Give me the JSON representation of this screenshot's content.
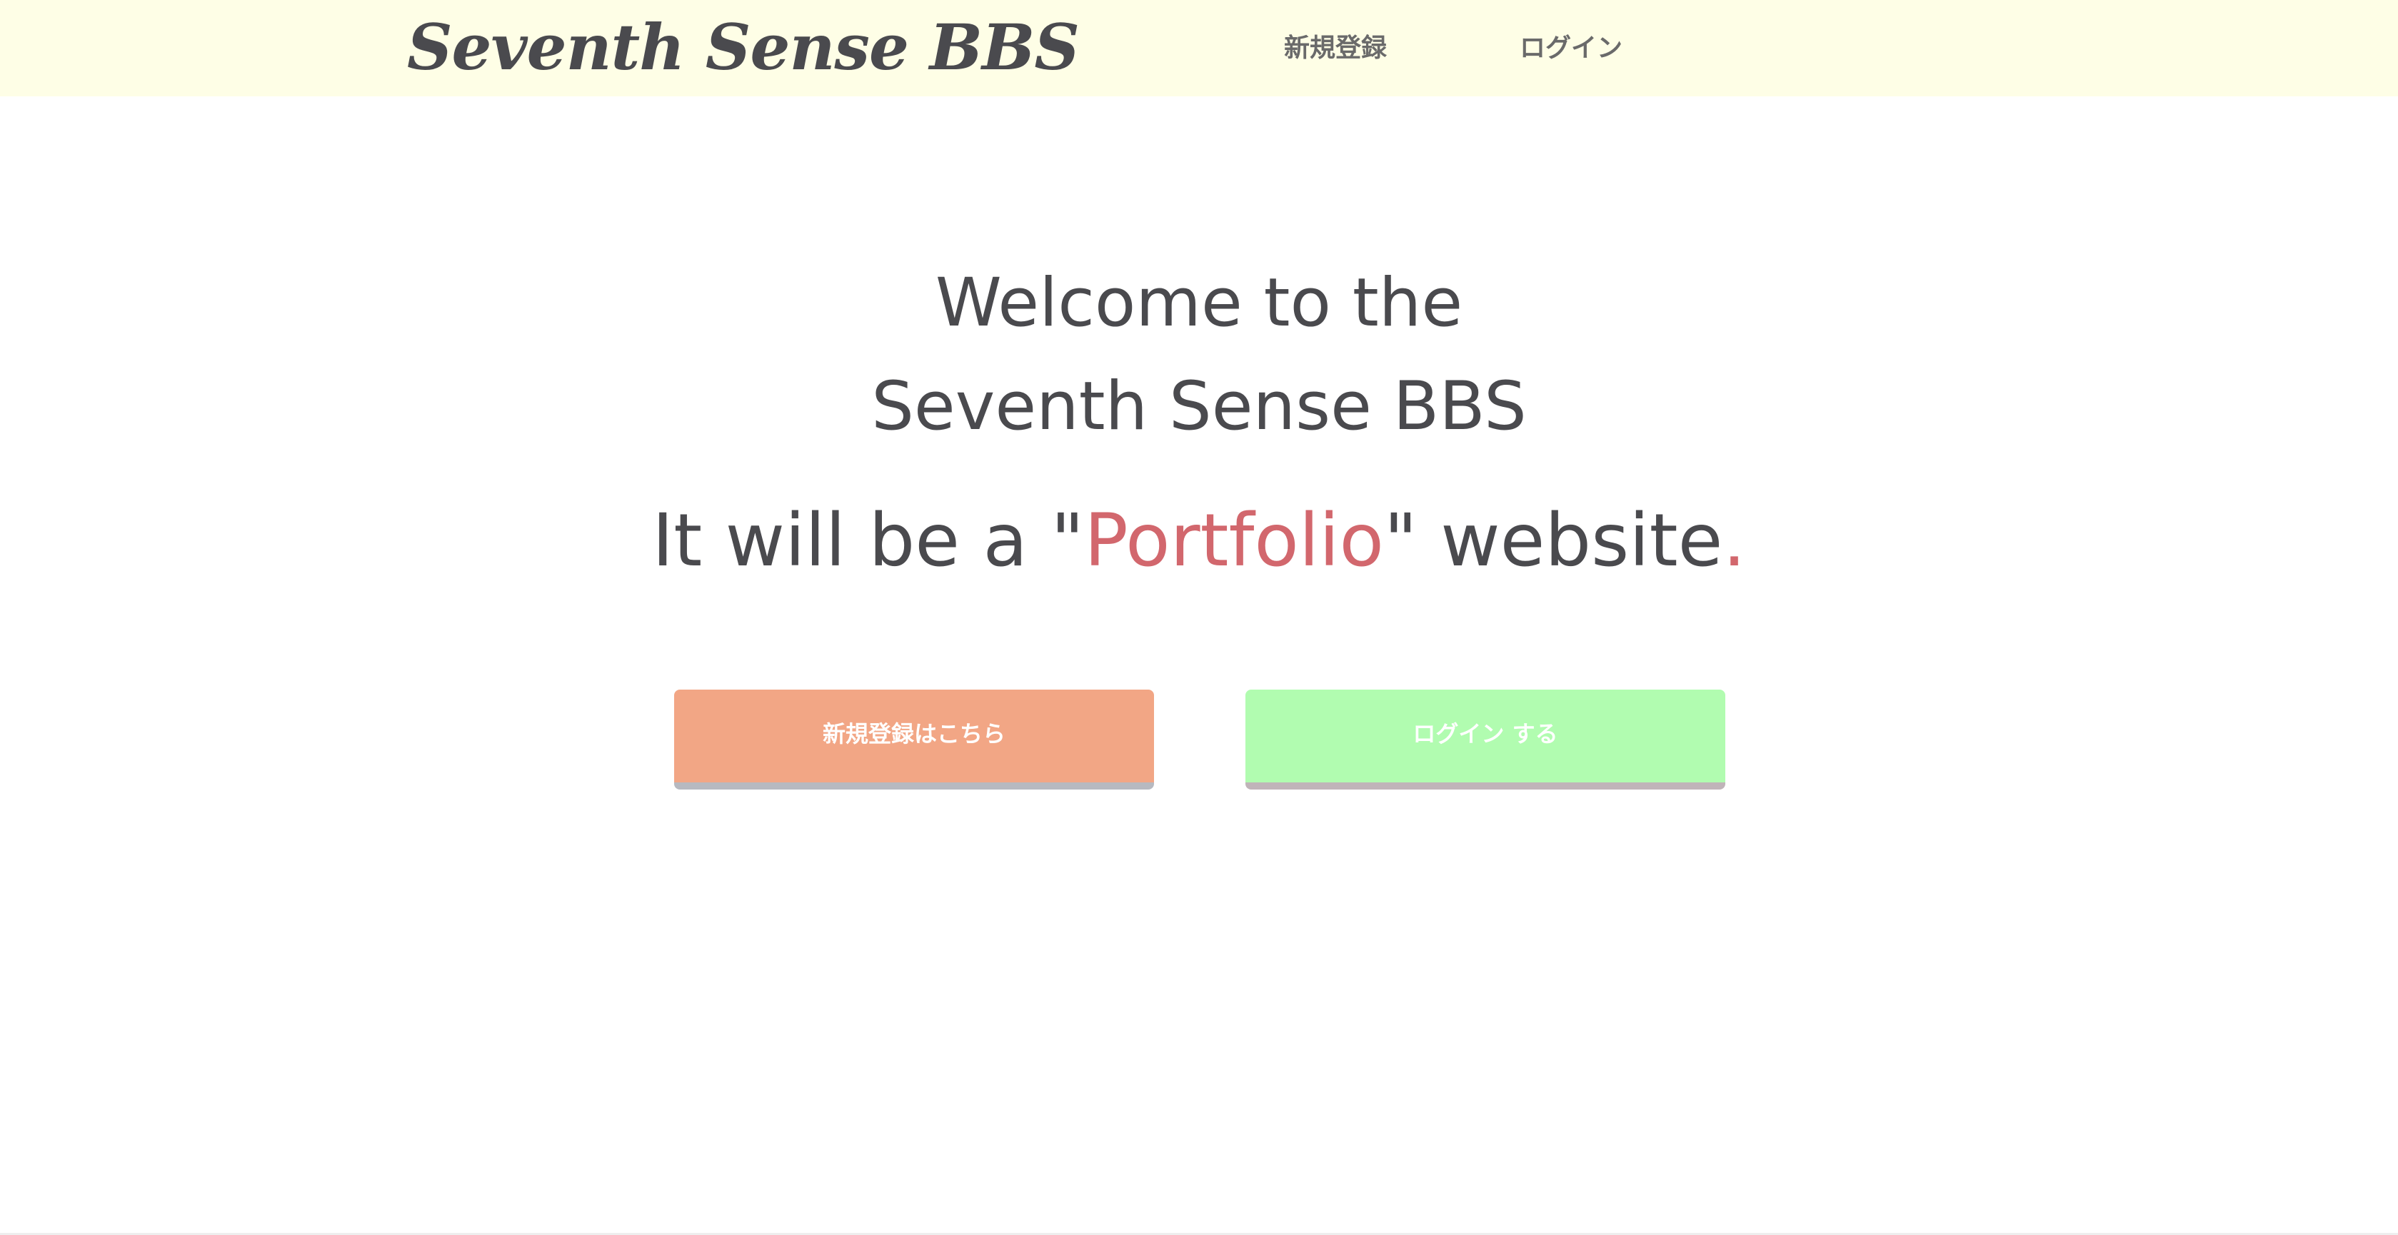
{
  "header": {
    "logo": "Seventh Sense BBS",
    "nav": {
      "signup": "新規登録",
      "login": "ログイン"
    }
  },
  "hero": {
    "line1": "Welcome to the",
    "line2": "Seventh Sense BBS",
    "tagline_before": "It will be a \"",
    "tagline_highlight": "Portfolio",
    "tagline_after": "\" website",
    "tagline_period": "."
  },
  "buttons": {
    "signup": "新規登録はこちら",
    "login": "ログイン する"
  },
  "colors": {
    "header_bg": "#fefee6",
    "text": "#4a4a4e",
    "accent": "#d2676d",
    "signup_button": "#f2a685",
    "login_button": "#b1fcb0"
  }
}
